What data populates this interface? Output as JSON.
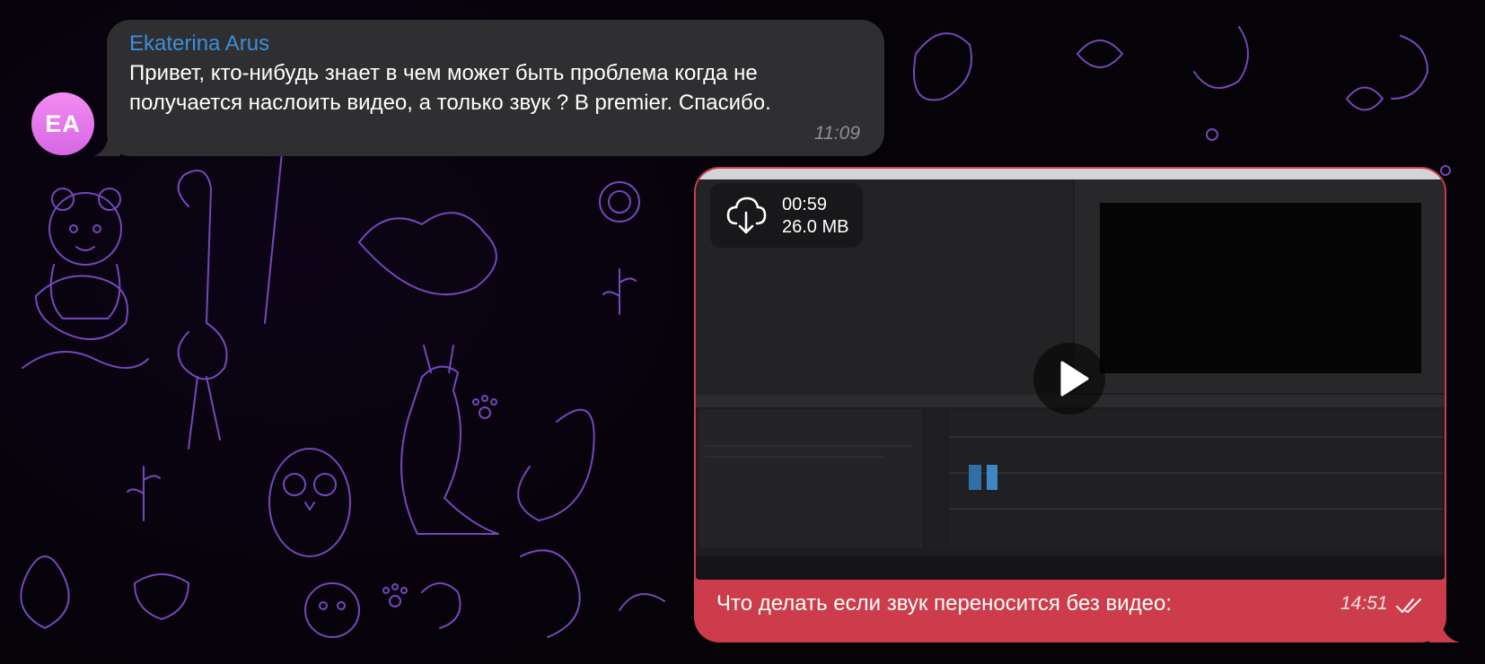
{
  "chat": {
    "incoming": {
      "avatar_initials": "EA",
      "sender": "Ekaterina Arus",
      "text": "Привет, кто-нибудь знает в чем может быть проблема когда не получается наслоить видео, а только звук ? В premier. Спасибо.",
      "time": "11:09"
    },
    "outgoing": {
      "video": {
        "duration": "00:59",
        "size": "26.0 MB",
        "download_icon": "cloud-download-icon",
        "play_icon": "play-icon"
      },
      "caption": "Что делать если звук переносится без видео:",
      "time": "14:51",
      "status_icon": "double-check-icon"
    }
  },
  "colors": {
    "background": "#050208",
    "doodle": "#8a52d8",
    "incoming_bubble": "#2f2f31",
    "outgoing_bubble": "#cc3c4a",
    "sender_name": "#3b8ed9",
    "avatar": "#e47ae9"
  }
}
